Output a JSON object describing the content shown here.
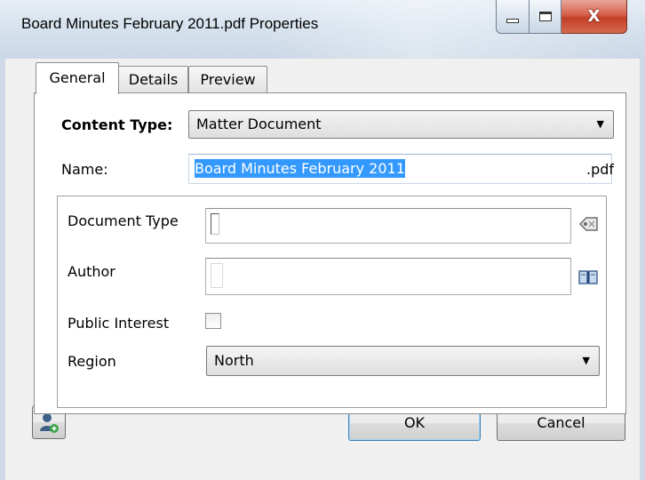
{
  "window": {
    "title": "Board Minutes February 2011.pdf Properties",
    "controls": {
      "minimize": "minimize-icon",
      "maximize": "maximize-icon",
      "close": "close-icon",
      "close_glyph": "X"
    }
  },
  "tabs": [
    {
      "label": "General",
      "active": true
    },
    {
      "label": "Details",
      "active": false
    },
    {
      "label": "Preview",
      "active": false
    }
  ],
  "general": {
    "content_type_label": "Content Type:",
    "content_type_value": "Matter Document",
    "name_label": "Name:",
    "name_value": "Board Minutes February 2011",
    "name_extension": ".pdf",
    "fields": {
      "document_type_label": "Document Type",
      "document_type_value": "",
      "author_label": "Author",
      "author_value": "",
      "public_interest_label": "Public Interest",
      "public_interest_checked": false,
      "region_label": "Region",
      "region_value": "North"
    }
  },
  "buttons": {
    "ok": "OK",
    "cancel": "Cancel",
    "user_icon": "user-add-icon",
    "lookup_icon": "tag-lookup-icon",
    "book_icon": "address-book-icon"
  }
}
